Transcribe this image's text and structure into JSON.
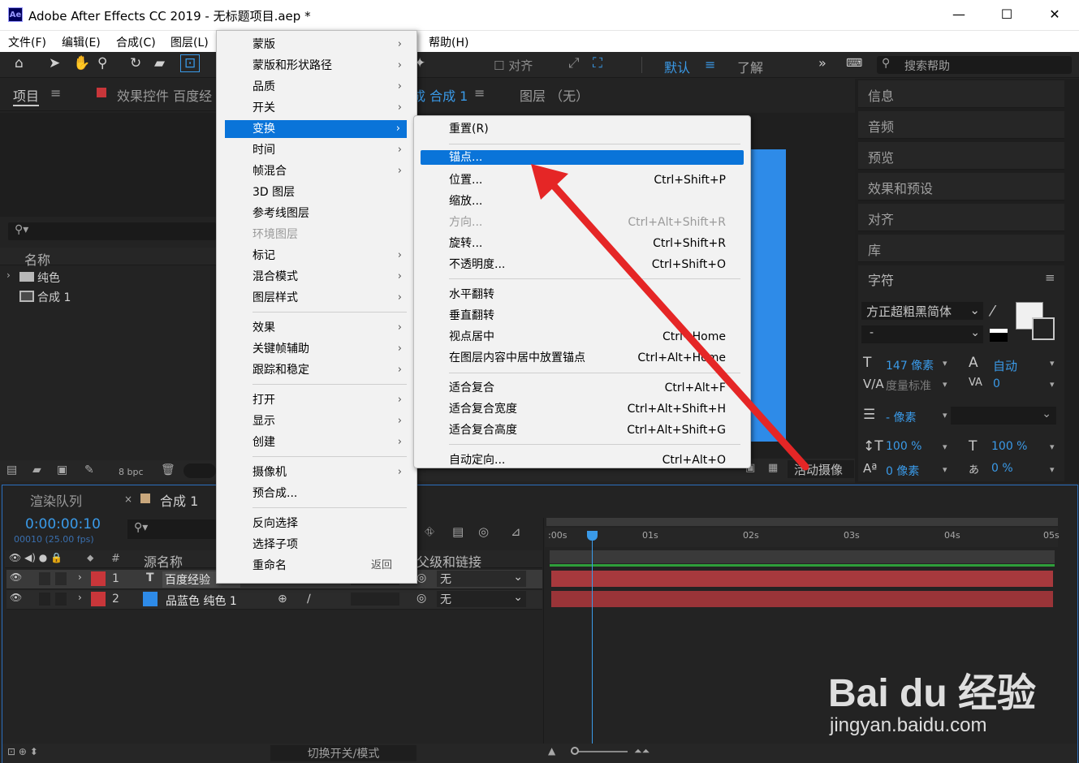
{
  "window": {
    "app_icon": "Ae",
    "title": "Adobe After Effects CC 2019 - 无标题项目.aep *",
    "minimize": "—",
    "maximize": "☐",
    "close": "✕"
  },
  "menubar": {
    "file": "文件(F)",
    "edit": "编辑(E)",
    "comp": "合成(C)",
    "layer": "图层(L)",
    "help": "帮助(H)"
  },
  "toolbar": {
    "align": "对齐",
    "default": "默认",
    "learn": "了解",
    "search_placeholder": "搜索帮助",
    "more": "»"
  },
  "project_panel": {
    "tab": "项目",
    "tab_menu": "≡",
    "effects_tab": "效果控件 百度经",
    "col_name": "名称",
    "items": [
      {
        "name": "纯色"
      },
      {
        "name": "合成 1"
      }
    ],
    "bpc": "8 bpc"
  },
  "comp_panel": {
    "tab": "成 合成 1",
    "tab_menu": "≡",
    "layer_tab": "图层 （无）",
    "camera": "活动摄像"
  },
  "right_panel": {
    "items": [
      "信息",
      "音频",
      "预览",
      "效果和预设",
      "对齐",
      "库"
    ],
    "char_title": "字符",
    "char_menu": "≡",
    "font": "方正超粗黑简体",
    "style": "-",
    "size": "147 像素",
    "leading": "自动",
    "kerning": "度量标准",
    "tracking": "0",
    "indent": "- 像素",
    "vscale": "100 %",
    "hscale": "100 %",
    "baseline": "0 像素",
    "tsume": "0 %"
  },
  "timeline": {
    "render_tab": "渲染队列",
    "close": "×",
    "comp_tab": "合成 1",
    "timecode": "0:00:00:10",
    "frames": "00010 (25.00 fps)",
    "col_num": "#",
    "col_source": "源名称",
    "col_parent": "父级和链接",
    "layers": [
      {
        "num": "1",
        "name": "百度经验",
        "parent": "无",
        "type_icon": "T",
        "color": "#c8363a"
      },
      {
        "num": "2",
        "name": "品蓝色 纯色 1",
        "parent": "无",
        "type_icon": "■",
        "color": "#c8363a"
      }
    ],
    "ticks": [
      ":00s",
      "01s",
      "02s",
      "03s",
      "04s",
      "05s"
    ],
    "toggle": "切换开关/模式"
  },
  "layer_menu": {
    "items": [
      {
        "label": "蒙版",
        "sub": true
      },
      {
        "label": "蒙版和形状路径",
        "sub": true
      },
      {
        "label": "品质",
        "sub": true
      },
      {
        "label": "开关",
        "sub": true
      },
      {
        "label": "变换",
        "sub": true,
        "selected": true
      },
      {
        "label": "时间",
        "sub": true
      },
      {
        "label": "帧混合",
        "sub": true
      },
      {
        "label": "3D 图层"
      },
      {
        "label": "参考线图层"
      },
      {
        "label": "环境图层",
        "disabled": true
      },
      {
        "label": "标记",
        "sub": true
      },
      {
        "label": "混合模式",
        "sub": true
      },
      {
        "label": "图层样式",
        "sub": true
      },
      {
        "label": "效果",
        "sub": true
      },
      {
        "label": "关键帧辅助",
        "sub": true
      },
      {
        "label": "跟踪和稳定",
        "sub": true
      },
      {
        "label": "打开",
        "sub": true
      },
      {
        "label": "显示",
        "sub": true
      },
      {
        "label": "创建",
        "sub": true
      },
      {
        "label": "摄像机",
        "sub": true
      },
      {
        "label": "预合成..."
      },
      {
        "label": "反向选择"
      },
      {
        "label": "选择子项"
      },
      {
        "label": "重命名",
        "shortcut": "返回"
      }
    ]
  },
  "transform_menu": {
    "items": [
      {
        "label": "重置(R)",
        "shortcut": ""
      },
      {
        "label": "锚点...",
        "shortcut": "",
        "selected": true
      },
      {
        "label": "位置...",
        "shortcut": "Ctrl+Shift+P"
      },
      {
        "label": "缩放...",
        "shortcut": ""
      },
      {
        "label": "方向...",
        "shortcut": "Ctrl+Alt+Shift+R",
        "disabled": true
      },
      {
        "label": "旋转...",
        "shortcut": "Ctrl+Shift+R"
      },
      {
        "label": "不透明度...",
        "shortcut": "Ctrl+Shift+O"
      },
      {
        "label": "水平翻转",
        "shortcut": ""
      },
      {
        "label": "垂直翻转",
        "shortcut": ""
      },
      {
        "label": "视点居中",
        "shortcut": "Ctrl+Home"
      },
      {
        "label": "在图层内容中居中放置锚点",
        "shortcut": "Ctrl+Alt+Home"
      },
      {
        "label": "适合复合",
        "shortcut": "Ctrl+Alt+F"
      },
      {
        "label": "适合复合宽度",
        "shortcut": "Ctrl+Alt+Shift+H"
      },
      {
        "label": "适合复合高度",
        "shortcut": "Ctrl+Alt+Shift+G"
      },
      {
        "label": "自动定向...",
        "shortcut": "Ctrl+Alt+O"
      }
    ]
  },
  "watermark": {
    "logo": "Bai du 经验",
    "url": "jingyan.baidu.com"
  },
  "colors": {
    "accent": "#0a74d9",
    "solid_blue": "#2e8be8",
    "layer_red": "#b63c40",
    "arrow": "#e52626",
    "timecode": "#3a9ae8"
  }
}
